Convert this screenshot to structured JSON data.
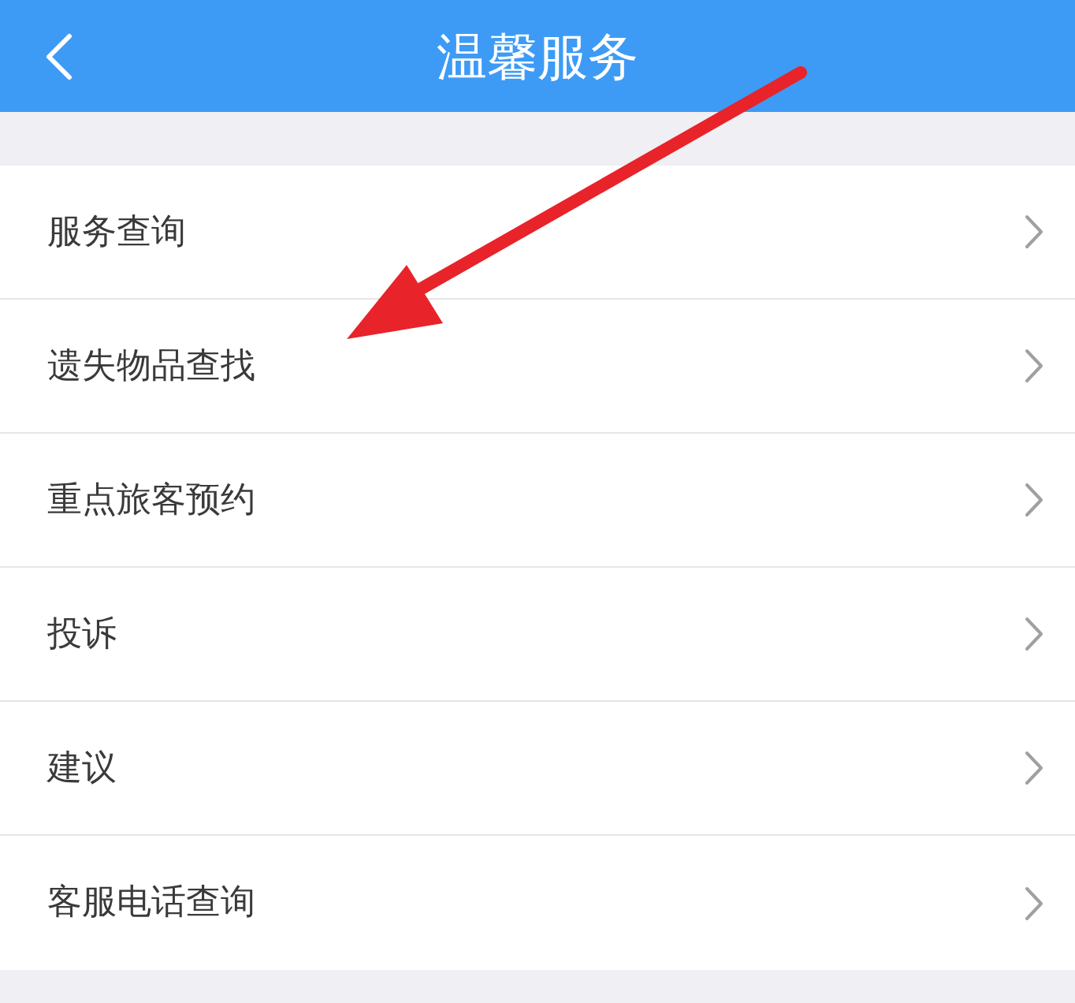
{
  "header": {
    "title": "温馨服务"
  },
  "menu": [
    {
      "label": "服务查询"
    },
    {
      "label": "遗失物品查找"
    },
    {
      "label": "重点旅客预约"
    },
    {
      "label": "投诉"
    },
    {
      "label": "建议"
    },
    {
      "label": "客服电话查询"
    }
  ]
}
